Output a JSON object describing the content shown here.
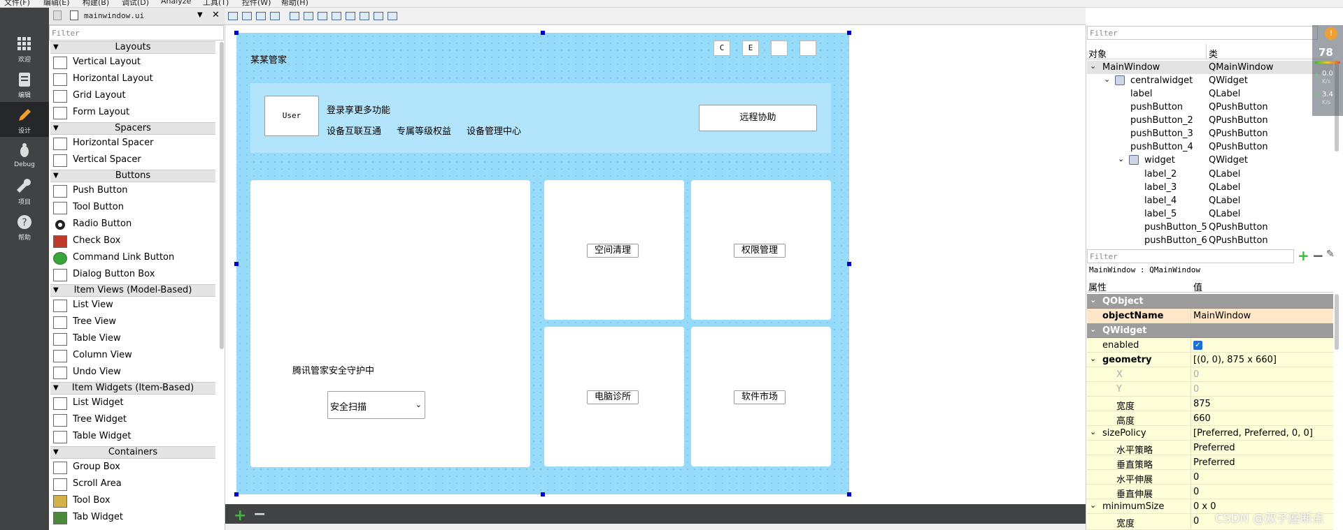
{
  "menubar": {
    "items": [
      "文件(F)",
      "编辑(E)",
      "构建(B)",
      "调试(D)",
      "Analyze",
      "工具(T)",
      "控件(W)",
      "帮助(H)"
    ]
  },
  "modes": [
    {
      "label": "欢迎",
      "icon": "grid-icon"
    },
    {
      "label": "编辑",
      "icon": "document-icon"
    },
    {
      "label": "设计",
      "icon": "pencil-icon"
    },
    {
      "label": "Debug",
      "icon": "bug-icon"
    },
    {
      "label": "项目",
      "icon": "wrench-icon"
    },
    {
      "label": "帮助",
      "icon": "help-icon"
    }
  ],
  "editor": {
    "file_name": "mainwindow.ui"
  },
  "widget_box": {
    "filter_placeholder": "Filter",
    "categories": {
      "layouts": "Layouts",
      "spacers": "Spacers",
      "buttons": "Buttons",
      "item_views": "Item Views (Model-Based)",
      "item_widgets": "Item Widgets (Item-Based)",
      "containers": "Containers"
    },
    "items": {
      "vertical_layout": "Vertical Layout",
      "horizontal_layout": "Horizontal Layout",
      "grid_layout": "Grid Layout",
      "form_layout": "Form Layout",
      "horizontal_spacer": "Horizontal Spacer",
      "vertical_spacer": "Vertical Spacer",
      "push_button": "Push Button",
      "tool_button": "Tool Button",
      "radio_button": "Radio Button",
      "check_box": "Check Box",
      "command_link_button": "Command Link Button",
      "dialog_button_box": "Dialog Button Box",
      "list_view": "List View",
      "tree_view": "Tree View",
      "table_view": "Table View",
      "column_view": "Column View",
      "undo_view": "Undo View",
      "list_widget": "List Widget",
      "tree_widget": "Tree Widget",
      "table_widget": "Table Widget",
      "group_box": "Group Box",
      "scroll_area": "Scroll Area",
      "tool_box": "Tool Box",
      "tab_widget": "Tab Widget"
    }
  },
  "form": {
    "title": "某某管家",
    "top_buttons": [
      "C",
      "E",
      "",
      ""
    ],
    "user_button": "User",
    "login_text": "登录享更多功能",
    "links": [
      "设备互联互通",
      "专属等级权益",
      "设备管理中心"
    ],
    "remote_button": "远程协助",
    "guard_text": "腾讯管家安全守护中",
    "combo_value": "安全扫描",
    "tiles": [
      "空间清理",
      "权限管理",
      "电脑诊所",
      "软件市场"
    ]
  },
  "object_inspector": {
    "filter_placeholder": "Filter",
    "col_object": "对象",
    "col_class": "类",
    "rows": [
      {
        "name": "MainWindow",
        "class": "QMainWindow"
      },
      {
        "name": "centralwidget",
        "class": "QWidget"
      },
      {
        "name": "label",
        "class": "QLabel"
      },
      {
        "name": "pushButton",
        "class": "QPushButton"
      },
      {
        "name": "pushButton_2",
        "class": "QPushButton"
      },
      {
        "name": "pushButton_3",
        "class": "QPushButton"
      },
      {
        "name": "pushButton_4",
        "class": "QPushButton"
      },
      {
        "name": "widget",
        "class": "QWidget"
      },
      {
        "name": "label_2",
        "class": "QLabel"
      },
      {
        "name": "label_3",
        "class": "QLabel"
      },
      {
        "name": "label_4",
        "class": "QLabel"
      },
      {
        "name": "label_5",
        "class": "QLabel"
      },
      {
        "name": "pushButton_5",
        "class": "QPushButton"
      },
      {
        "name": "pushButton_6",
        "class": "QPushButton"
      }
    ]
  },
  "property_editor": {
    "filter_placeholder": "Filter",
    "class_line": "MainWindow : QMainWindow",
    "col_property": "属性",
    "col_value": "值",
    "rows": [
      {
        "name": "QObject",
        "value": ""
      },
      {
        "name": "objectName",
        "value": "MainWindow"
      },
      {
        "name": "QWidget",
        "value": ""
      },
      {
        "name": "enabled",
        "value": "✓"
      },
      {
        "name": "geometry",
        "value": "[(0, 0), 875 x 660]"
      },
      {
        "name": "X",
        "value": "0"
      },
      {
        "name": "Y",
        "value": "0"
      },
      {
        "name": "宽度",
        "value": "875"
      },
      {
        "name": "高度",
        "value": "660"
      },
      {
        "name": "sizePolicy",
        "value": "[Preferred, Preferred, 0, 0]"
      },
      {
        "name": "水平策略",
        "value": "Preferred"
      },
      {
        "name": "垂直策略",
        "value": "Preferred"
      },
      {
        "name": "水平伸展",
        "value": "0"
      },
      {
        "name": "垂直伸展",
        "value": "0"
      },
      {
        "name": "minimumSize",
        "value": "0 x 0"
      },
      {
        "name": "宽度",
        "value": "0"
      }
    ]
  },
  "net_monitor": {
    "percent": "78",
    "down": "0.0",
    "down_unit": "K/s",
    "up": "3.4",
    "up_unit": "K/s",
    "badge": "!"
  },
  "watermark": "CSDN @双子座断点",
  "colors": {
    "form_bg": "#96dcfa",
    "mode_bar": "#404244",
    "accent": "#1e6fd1"
  }
}
